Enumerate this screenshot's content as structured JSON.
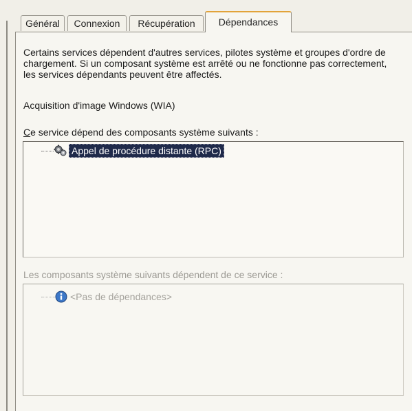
{
  "tabs": [
    {
      "label": "Général",
      "active": false
    },
    {
      "label": "Connexion",
      "active": false
    },
    {
      "label": "Récupération",
      "active": false
    },
    {
      "label": "Dépendances",
      "active": true
    }
  ],
  "description": "Certains services dépendent d'autres services, pilotes système et groupes d'ordre de chargement. Si un composant système est arrêté ou ne fonctionne pas correctement, les services dépendants peuvent être affectés.",
  "service_name": "Acquisition d'image Windows (WIA)",
  "depends_on": {
    "label_accel": "C",
    "label_rest": "e service dépend des composants système suivants :",
    "items": [
      {
        "label": "Appel de procédure distante (RPC)",
        "icon": "gear-icon",
        "selected": true
      }
    ]
  },
  "dependents": {
    "label": "Les composants système suivants dépendent de ce service :",
    "items": [
      {
        "label": "<Pas de dépendances>",
        "icon": "info-icon"
      }
    ]
  },
  "colors": {
    "selection": "#1f2a4a",
    "active_tab_accent": "#e2a33a",
    "disabled_text": "#9c9a94"
  }
}
